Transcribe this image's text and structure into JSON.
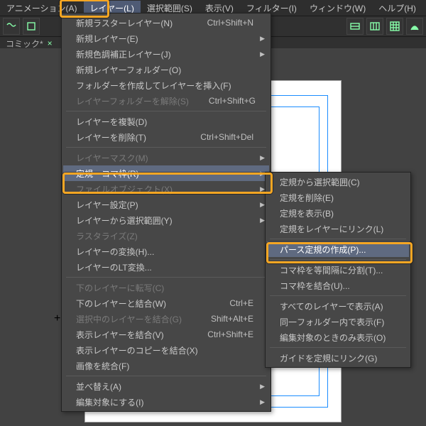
{
  "menubar": {
    "items": [
      {
        "label": "アニメーション(A)"
      },
      {
        "label": "レイヤー(L)",
        "active": true
      },
      {
        "label": "選択範囲(S)"
      },
      {
        "label": "表示(V)"
      },
      {
        "label": "フィルター(I)"
      },
      {
        "label": "ウィンドウ(W)"
      },
      {
        "label": "ヘルプ(H)"
      }
    ]
  },
  "tab": {
    "label": "コミック*"
  },
  "menu": {
    "items": [
      {
        "label": "新規ラスターレイヤー(N)",
        "shortcut": "Ctrl+Shift+N"
      },
      {
        "label": "新規レイヤー(E)",
        "sub": true
      },
      {
        "label": "新規色調補正レイヤー(J)",
        "sub": true
      },
      {
        "label": "新規レイヤーフォルダー(O)"
      },
      {
        "label": "フォルダーを作成してレイヤーを挿入(F)"
      },
      {
        "label": "レイヤーフォルダーを解除(S)",
        "shortcut": "Ctrl+Shift+G",
        "disabled": true
      },
      {
        "sep": true
      },
      {
        "label": "レイヤーを複製(D)"
      },
      {
        "label": "レイヤーを削除(T)",
        "shortcut": "Ctrl+Shift+Del"
      },
      {
        "sep": true
      },
      {
        "label": "レイヤーマスク(M)",
        "sub": true,
        "disabled": true
      },
      {
        "label": "定規・コマ枠(R)",
        "sub": true,
        "hover": true
      },
      {
        "label": "ファイルオブジェクト(X)",
        "sub": true,
        "disabled": true
      },
      {
        "label": "レイヤー設定(P)",
        "sub": true
      },
      {
        "label": "レイヤーから選択範囲(Y)",
        "sub": true
      },
      {
        "label": "ラスタライズ(Z)",
        "disabled": true
      },
      {
        "label": "レイヤーの変換(H)..."
      },
      {
        "label": "レイヤーのLT変換..."
      },
      {
        "sep": true
      },
      {
        "label": "下のレイヤーに転写(C)",
        "disabled": true
      },
      {
        "label": "下のレイヤーと結合(W)",
        "shortcut": "Ctrl+E"
      },
      {
        "label": "選択中のレイヤーを結合(G)",
        "shortcut": "Shift+Alt+E",
        "disabled": true
      },
      {
        "label": "表示レイヤーを結合(V)",
        "shortcut": "Ctrl+Shift+E"
      },
      {
        "label": "表示レイヤーのコピーを結合(X)"
      },
      {
        "label": "画像を統合(F)"
      },
      {
        "sep": true
      },
      {
        "label": "並べ替え(A)",
        "sub": true
      },
      {
        "label": "編集対象にする(I)",
        "sub": true
      }
    ]
  },
  "submenu": {
    "items": [
      {
        "label": "定規から選択範囲(C)"
      },
      {
        "label": "定規を削除(E)"
      },
      {
        "label": "定規を表示(B)"
      },
      {
        "label": "定規をレイヤーにリンク(L)"
      },
      {
        "sep": true
      },
      {
        "label": "パース定規の作成(P)...",
        "hover": true
      },
      {
        "sep": true
      },
      {
        "label": "コマ枠を等間隔に分割(T)..."
      },
      {
        "label": "コマ枠を結合(U)..."
      },
      {
        "sep": true
      },
      {
        "label": "すべてのレイヤーで表示(A)"
      },
      {
        "label": "同一フォルダー内で表示(F)"
      },
      {
        "label": "編集対象のときのみ表示(O)"
      },
      {
        "sep": true
      },
      {
        "label": "ガイドを定規にリンク(G)"
      }
    ]
  }
}
